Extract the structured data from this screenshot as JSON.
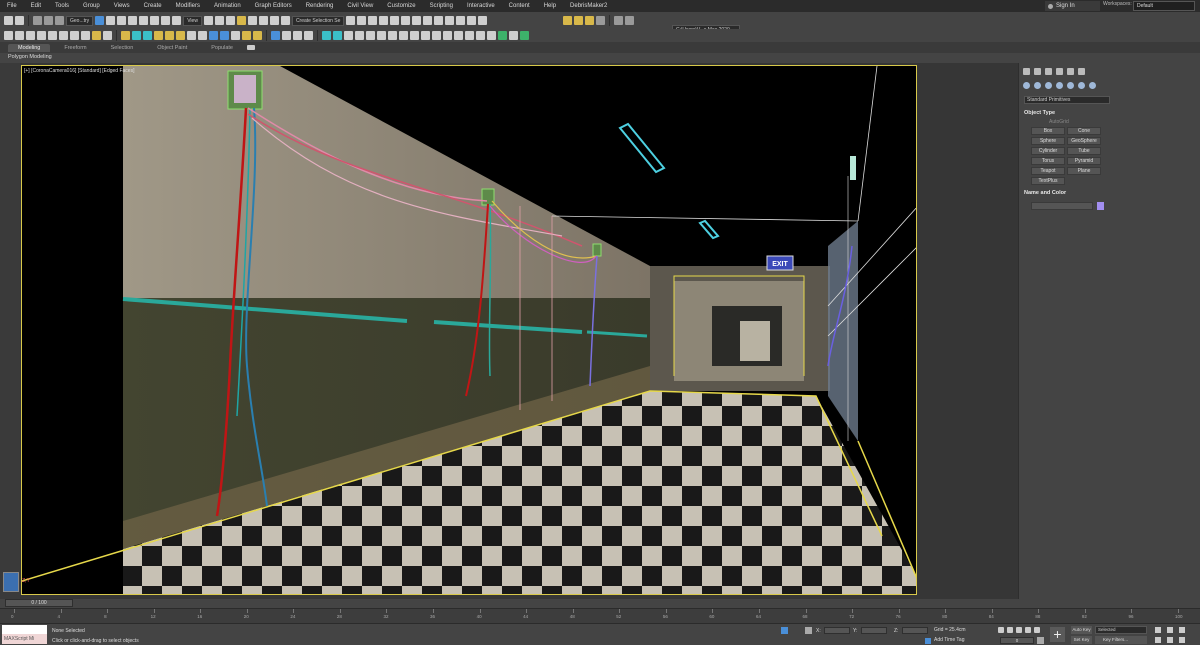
{
  "menu": {
    "items": [
      "File",
      "Edit",
      "Tools",
      "Group",
      "Views",
      "Create",
      "Modifiers",
      "Animation",
      "Graph Editors",
      "Rendering",
      "Civil View",
      "Customize",
      "Scripting",
      "Interactive",
      "Content",
      "Help",
      "DebrisMaker2"
    ],
    "sign_in": "Sign In",
    "workspaces_label": "Workspaces:",
    "workspace_value": "Default"
  },
  "toolbar": {
    "selection_filter": "Geo...try",
    "ref_coord": "View",
    "named_selection": "Create Selection Se",
    "project_path": "C:\\Users\\V...s Max 2020"
  },
  "ribbon": {
    "tabs": [
      "Modeling",
      "Freeform",
      "Selection",
      "Object Paint",
      "Populate"
    ],
    "panel_label": "Polygon Modeling"
  },
  "viewport": {
    "label": "[+] [CoronaCamera016] [Standard] [Edged Faces]",
    "axis": "Z,Y",
    "exit_sign": "EXIT"
  },
  "command_panel": {
    "category": "Standard Primitives",
    "object_type_title": "Object Type",
    "autogrid": "AutoGrid",
    "primitives": [
      "Box",
      "Cone",
      "Sphere",
      "GeoSphere",
      "Cylinder",
      "Tube",
      "Torus",
      "Pyramid",
      "Teapot",
      "Plane",
      "TextPlus"
    ],
    "name_color_title": "Name and Color"
  },
  "timeline": {
    "frame_display": "0 / 100",
    "ticks": [
      "0",
      "4",
      "8",
      "12",
      "16",
      "20",
      "24",
      "28",
      "32",
      "36",
      "40",
      "44",
      "48",
      "52",
      "56",
      "60",
      "64",
      "68",
      "72",
      "76",
      "80",
      "84",
      "88",
      "92",
      "96",
      "100"
    ]
  },
  "status": {
    "maxscript": "MAXScript Mi",
    "selection": "None Selected",
    "prompt": "Click or click-and-drag to select objects",
    "x_label": "X:",
    "y_label": "Y:",
    "z_label": "Z:",
    "grid": "Grid = 25.4cm",
    "add_time_tag": "Add Time Tag",
    "auto_key": "Auto Key",
    "set_key": "Set Key",
    "selected": "Selected",
    "key_filters": "Key Filters...",
    "frame": "0"
  }
}
